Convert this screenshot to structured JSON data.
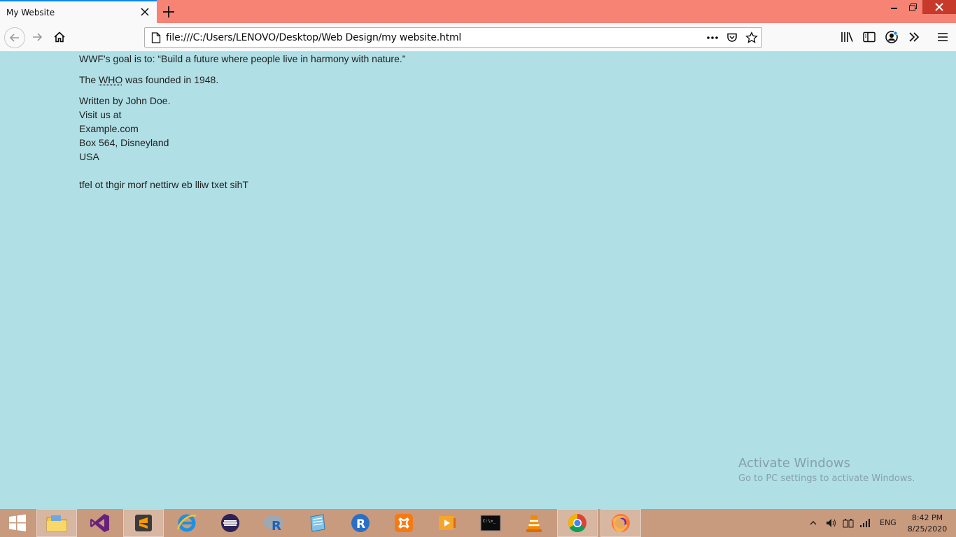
{
  "browser": {
    "tab_title": "My Website",
    "url": "file:///C:/Users/LENOVO/Desktop/Web Design/my website.html",
    "accent_color": "#0a84ff",
    "titlebar_color": "#f78375"
  },
  "page": {
    "quote_line": {
      "prefix": "WWF's goal is to: ",
      "quote": "“Build a future where people live in harmony with nature.”"
    },
    "who_line": {
      "prefix": "The ",
      "abbr": "WHO",
      "suffix": " was founded in 1948."
    },
    "address": {
      "lines": [
        "Written by John Doe.",
        "Visit us at",
        "Example.com",
        "Box 564, Disneyland",
        "USA"
      ]
    },
    "rtl_text": "tfel ot thgir morf nettirw eb lliw txet sihT",
    "background_color": "#b0dfe5"
  },
  "watermark": {
    "title": "Activate Windows",
    "subtitle": "Go to PC settings to activate Windows."
  },
  "taskbar": {
    "apps": [
      {
        "name": "file-explorer"
      },
      {
        "name": "visual-studio"
      },
      {
        "name": "sublime-text"
      },
      {
        "name": "internet-explorer"
      },
      {
        "name": "eclipse"
      },
      {
        "name": "rstudio"
      },
      {
        "name": "notepad"
      },
      {
        "name": "r-gui"
      },
      {
        "name": "xampp"
      },
      {
        "name": "media-player"
      },
      {
        "name": "command-prompt"
      },
      {
        "name": "vlc"
      },
      {
        "name": "chrome"
      },
      {
        "name": "firefox"
      }
    ],
    "language": "ENG",
    "time": "8:42 PM",
    "date": "8/25/2020"
  }
}
